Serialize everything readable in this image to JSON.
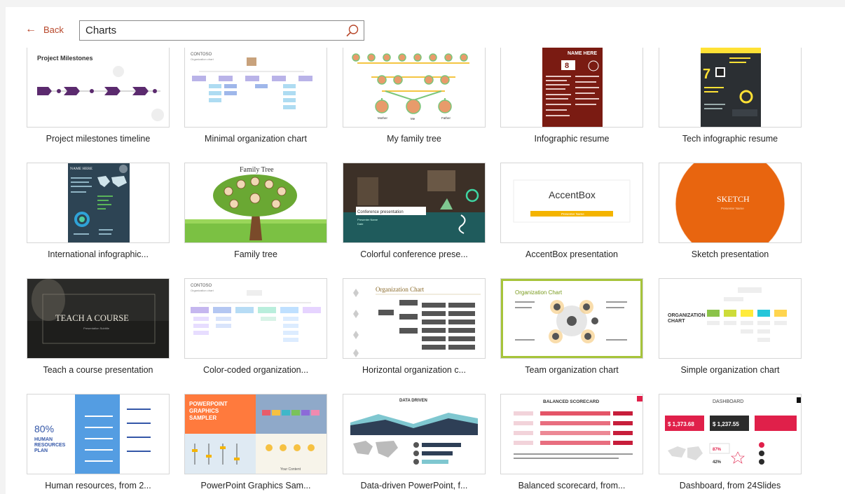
{
  "header": {
    "back_label": "Back",
    "search_value": "Charts"
  },
  "templates": [
    {
      "title": "Project milestones timeline",
      "thumb_text": [
        "Project Milestones"
      ]
    },
    {
      "title": "Minimal organization chart",
      "thumb_text": [
        "CONTOSO",
        "Organization chart"
      ]
    },
    {
      "title": "My family tree",
      "thumb_text": [
        "Mother",
        "Me",
        "Father"
      ]
    },
    {
      "title": "Infographic resume",
      "thumb_text": [
        "NAME HERE",
        "8"
      ]
    },
    {
      "title": "Tech infographic resume",
      "thumb_text": [
        "7"
      ]
    },
    {
      "title": "International infographic...",
      "thumb_text": [
        "NAME HERE"
      ]
    },
    {
      "title": "Family tree",
      "thumb_text": [
        "Family Tree"
      ]
    },
    {
      "title": "Colorful conference prese...",
      "thumb_text": [
        "Conference presentation",
        "Presenter Name",
        "Date"
      ]
    },
    {
      "title": "AccentBox presentation",
      "thumb_text": [
        "AccentBox",
        "Presenter Name"
      ]
    },
    {
      "title": "Sketch presentation",
      "thumb_text": [
        "SKETCH",
        "Presenter Name"
      ]
    },
    {
      "title": "Teach a course presentation",
      "thumb_text": [
        "TEACH A COURSE",
        "Presentation Subtitle"
      ]
    },
    {
      "title": "Color-coded organization...",
      "thumb_text": [
        "CONTOSO",
        "Organization chart"
      ]
    },
    {
      "title": "Horizontal organization c...",
      "thumb_text": [
        "Organization Chart"
      ]
    },
    {
      "title": "Team organization chart",
      "thumb_text": [
        "Organization Chart"
      ]
    },
    {
      "title": "Simple organization chart",
      "thumb_text": [
        "ORGANIZATION",
        "CHART"
      ]
    },
    {
      "title": "Human resources, from 2...",
      "thumb_text": [
        "80%",
        "HUMAN",
        "RESOURCES",
        "PLAN"
      ]
    },
    {
      "title": "PowerPoint Graphics Sam...",
      "thumb_text": [
        "POWERPOINT",
        "GRAPHICS",
        "SAMPLER",
        "Your Content"
      ]
    },
    {
      "title": "Data-driven PowerPoint, f...",
      "thumb_text": [
        "DATA DRIVEN"
      ]
    },
    {
      "title": "Balanced scorecard, from...",
      "thumb_text": [
        "BALANCED SCORECARD"
      ]
    },
    {
      "title": "Dashboard, from 24Slides",
      "thumb_text": [
        "DASHBOARD",
        "$ 1,373.68",
        "$ 1,237.55",
        "87%",
        "42%"
      ]
    }
  ],
  "colors": {
    "accent": "#b7472a",
    "conference_teal": "#1f5b5c",
    "sketch_orange": "#e8650f",
    "accentbox_yellow": "#f4b400",
    "resume_red": "#7a1b12",
    "tech_dark": "#2b2f33"
  }
}
